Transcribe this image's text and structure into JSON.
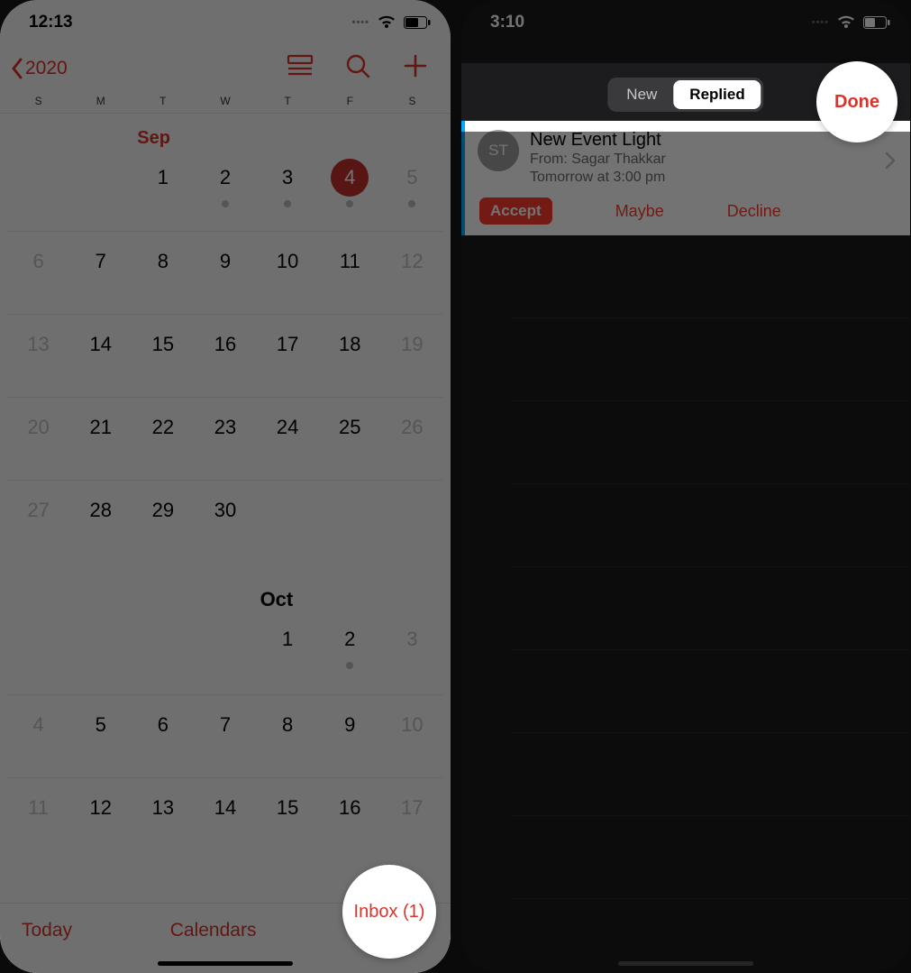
{
  "left": {
    "status": {
      "time": "12:13"
    },
    "nav": {
      "back_year": "2020"
    },
    "dow": [
      "S",
      "M",
      "T",
      "W",
      "T",
      "F",
      "S"
    ],
    "sep": {
      "label": "Sep",
      "weeks": [
        [
          null,
          null,
          {
            "n": "1"
          },
          {
            "n": "2",
            "dot": true
          },
          {
            "n": "3",
            "dot": true
          },
          {
            "n": "4",
            "dot": true,
            "today": true
          },
          {
            "n": "5",
            "dot": true,
            "gray": true
          }
        ],
        [
          {
            "n": "6",
            "gray": true
          },
          {
            "n": "7"
          },
          {
            "n": "8"
          },
          {
            "n": "9"
          },
          {
            "n": "10"
          },
          {
            "n": "11"
          },
          {
            "n": "12",
            "gray": true
          }
        ],
        [
          {
            "n": "13",
            "gray": true
          },
          {
            "n": "14"
          },
          {
            "n": "15"
          },
          {
            "n": "16"
          },
          {
            "n": "17"
          },
          {
            "n": "18"
          },
          {
            "n": "19",
            "gray": true
          }
        ],
        [
          {
            "n": "20",
            "gray": true
          },
          {
            "n": "21"
          },
          {
            "n": "22"
          },
          {
            "n": "23"
          },
          {
            "n": "24"
          },
          {
            "n": "25"
          },
          {
            "n": "26",
            "gray": true
          }
        ],
        [
          {
            "n": "27",
            "gray": true
          },
          {
            "n": "28"
          },
          {
            "n": "29"
          },
          {
            "n": "30"
          },
          null,
          null,
          null
        ]
      ]
    },
    "oct": {
      "label": "Oct",
      "weeks": [
        [
          null,
          null,
          null,
          null,
          {
            "n": "1"
          },
          {
            "n": "2",
            "dot": true
          },
          {
            "n": "3",
            "gray": true
          }
        ],
        [
          {
            "n": "4",
            "gray": true
          },
          {
            "n": "5"
          },
          {
            "n": "6"
          },
          {
            "n": "7"
          },
          {
            "n": "8"
          },
          {
            "n": "9"
          },
          {
            "n": "10",
            "gray": true
          }
        ],
        [
          {
            "n": "11",
            "gray": true
          },
          {
            "n": "12"
          },
          {
            "n": "13"
          },
          {
            "n": "14"
          },
          {
            "n": "15"
          },
          {
            "n": "16"
          },
          {
            "n": "17",
            "gray": true
          }
        ]
      ]
    },
    "toolbar": {
      "today": "Today",
      "calendars": "Calendars",
      "inbox": "Inbox (1)"
    }
  },
  "right": {
    "status": {
      "time": "3:10"
    },
    "segments": {
      "new": "New",
      "replied": "Replied"
    },
    "done": "Done",
    "invite": {
      "avatar": "ST",
      "title": "New Event Light",
      "from": "From: Sagar Thakkar",
      "when": "Tomorrow at 3:00 pm",
      "accept": "Accept",
      "maybe": "Maybe",
      "decline": "Decline"
    }
  }
}
